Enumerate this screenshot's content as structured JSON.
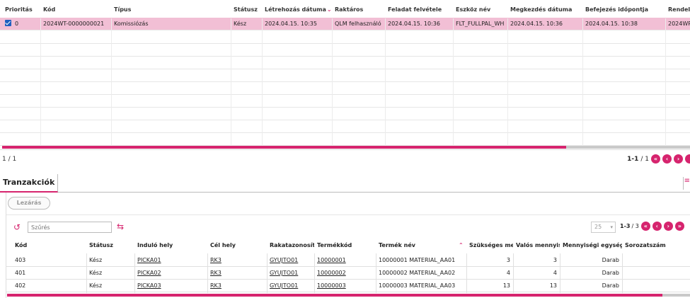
{
  "top_grid": {
    "columns": [
      "Prioritás",
      "Kód",
      "Típus",
      "Státusz",
      "Létrehozás dátuma",
      "Raktáros",
      "Feladat felvétele",
      "Eszköz név",
      "Megkezdés dátuma",
      "Befejezés időpontja",
      "Rendel"
    ],
    "rows": [
      [
        "0",
        "2024WT-0000000021",
        "Komissiózás",
        "Kész",
        "2024.04.15. 10:35",
        "QLM felhasználó",
        "2024.04.15. 10:36",
        "FLT_FULLPAL_WH",
        "2024.04.15. 10:36",
        "2024.04.15. 10:38",
        "2024WR"
      ]
    ],
    "scroll_fraction": 0.82,
    "pager_left": "1  /  1",
    "pager_count": "1-1",
    "pager_total": "/ 1"
  },
  "tabs": {
    "active": "Tranzakciók"
  },
  "panel": {
    "close_label": "Lezárás",
    "filter_placeholder": "Szűrés",
    "page_size": "25",
    "pager_count": "1-3",
    "pager_total": "/ 3"
  },
  "bottom_grid": {
    "columns": [
      "Kód",
      "Státusz",
      "Induló hely",
      "Cél hely",
      "Rakatazonosít",
      "Termékkód",
      "Termék név",
      "Szükséges men",
      "Valós mennyis",
      "Mennyiségi egység",
      "Sorozatszám"
    ],
    "rows": [
      [
        "403",
        "Kész",
        "PICKA01",
        "RK3",
        "GYUJTO01",
        "10000001",
        "10000001 MATERIAL_AA01",
        "3",
        "3",
        "Darab",
        ""
      ],
      [
        "401",
        "Kész",
        "PICKA02",
        "RK3",
        "GYUJTO01",
        "10000002",
        "10000002 MATERIAL_AA02",
        "4",
        "4",
        "Darab",
        ""
      ],
      [
        "402",
        "Kész",
        "PICKA03",
        "RK3",
        "GYUJTO01",
        "10000003",
        "10000003 MATERIAL_AA03",
        "13",
        "13",
        "Darab",
        ""
      ]
    ],
    "scroll_fraction": 0.96
  },
  "colors": {
    "accent": "#d6246e",
    "selected_row": "#f2bfd5",
    "checkbox": "#1f5fbf"
  },
  "icons": [
    "checkbox-checked-icon",
    "sort-down-icon",
    "sort-up-icon",
    "refresh-icon",
    "swap-icon",
    "first-page-icon",
    "prev-page-icon",
    "next-page-icon",
    "last-page-icon",
    "filter-icon"
  ]
}
